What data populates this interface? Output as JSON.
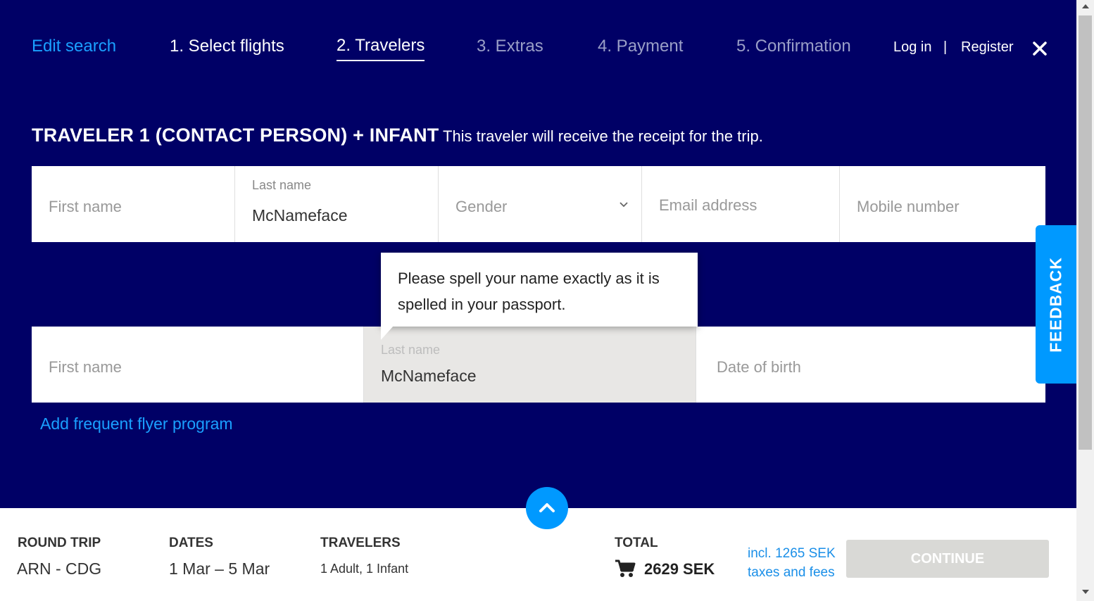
{
  "nav": {
    "edit_search": "Edit search",
    "steps": [
      {
        "label": "1. Select flights"
      },
      {
        "label": "2. Travelers"
      },
      {
        "label": "3. Extras"
      },
      {
        "label": "4. Payment"
      },
      {
        "label": "5. Confirmation"
      }
    ],
    "login": "Log in",
    "separator": "|",
    "register": "Register",
    "close_icon": "close-icon"
  },
  "traveler": {
    "title": "TRAVELER 1 (CONTACT PERSON) + INFANT",
    "subtitle": "This traveler will receive the receipt for the trip.",
    "adult": {
      "first_name_placeholder": "First name",
      "last_name_label": "Last name",
      "last_name_value": "McNameface",
      "gender_placeholder": "Gender",
      "email_placeholder": "Email address",
      "mobile_placeholder": "Mobile number"
    },
    "infant": {
      "first_name_placeholder": "First name",
      "last_name_label": "Last name",
      "last_name_value": "McNameface",
      "dob_placeholder": "Date of birth"
    },
    "tooltip": "Please spell your name exactly as it is spelled in your passport.",
    "frequent_flyer_link": "Add frequent flyer program"
  },
  "feedback": "FEEDBACK",
  "footer": {
    "trip_type_label": "ROUND TRIP",
    "route": "ARN - CDG",
    "dates_label": "DATES",
    "dates_value": "1 Mar – 5 Mar",
    "travelers_label": "TRAVELERS",
    "travelers_value": "1 Adult, 1 Infant",
    "total_label": "TOTAL",
    "total_value": "2629 SEK",
    "taxes_note": "incl. 1265 SEK taxes and fees",
    "continue_label": "CONTINUE"
  },
  "colors": {
    "background": "#000066",
    "accent": "#0099ff",
    "link": "#1aa0ff",
    "disabled_button": "#d9d9d6"
  }
}
